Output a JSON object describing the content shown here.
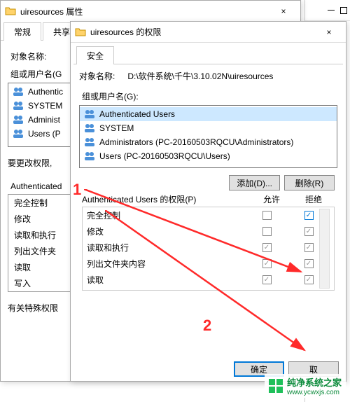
{
  "explorer": {
    "min": "–",
    "max": "□"
  },
  "win1": {
    "title": "uiresources 属性",
    "close": "×",
    "tabs": [
      "常规",
      "共享"
    ],
    "obj_label": "对象名称:",
    "group_label": "组或用户名(G",
    "users": [
      "Authentic",
      "SYSTEM",
      "Administ",
      "Users (P"
    ],
    "change_label": "要更改权限,",
    "perm_of": "Authenticated",
    "perms": [
      "完全控制",
      "修改",
      "读取和执行",
      "列出文件夹",
      "读取",
      "写入"
    ],
    "special_label": "有关特殊权限"
  },
  "win2": {
    "title": "uiresources 的权限",
    "close": "×",
    "tab": "安全",
    "obj_label": "对象名称:",
    "obj_value": "D:\\软件系统\\千牛\\3.10.02N\\uiresources",
    "group_label": "组或用户名(G):",
    "users": [
      "Authenticated Users",
      "SYSTEM",
      "Administrators (PC-20160503RQCU\\Administrators)",
      "Users (PC-20160503RQCU\\Users)"
    ],
    "add_btn": "添加(D)...",
    "remove_btn": "删除(R)",
    "perm_label": "Authenticated Users 的权限(P)",
    "col_allow": "允许",
    "col_deny": "拒绝",
    "perms": [
      {
        "name": "完全控制",
        "allow": false,
        "deny": true,
        "deny_blue": true
      },
      {
        "name": "修改",
        "allow": false,
        "deny": true
      },
      {
        "name": "读取和执行",
        "allow": true,
        "deny": true
      },
      {
        "name": "列出文件夹内容",
        "allow": true,
        "deny": true
      },
      {
        "name": "读取",
        "allow": true,
        "deny": true
      }
    ],
    "ok_btn": "确定",
    "cancel_btn": "取"
  },
  "anno": {
    "one": "1",
    "two": "2"
  },
  "watermark": {
    "line1": "纯净系统之家",
    "line2": "www.ycwxjs.com"
  }
}
